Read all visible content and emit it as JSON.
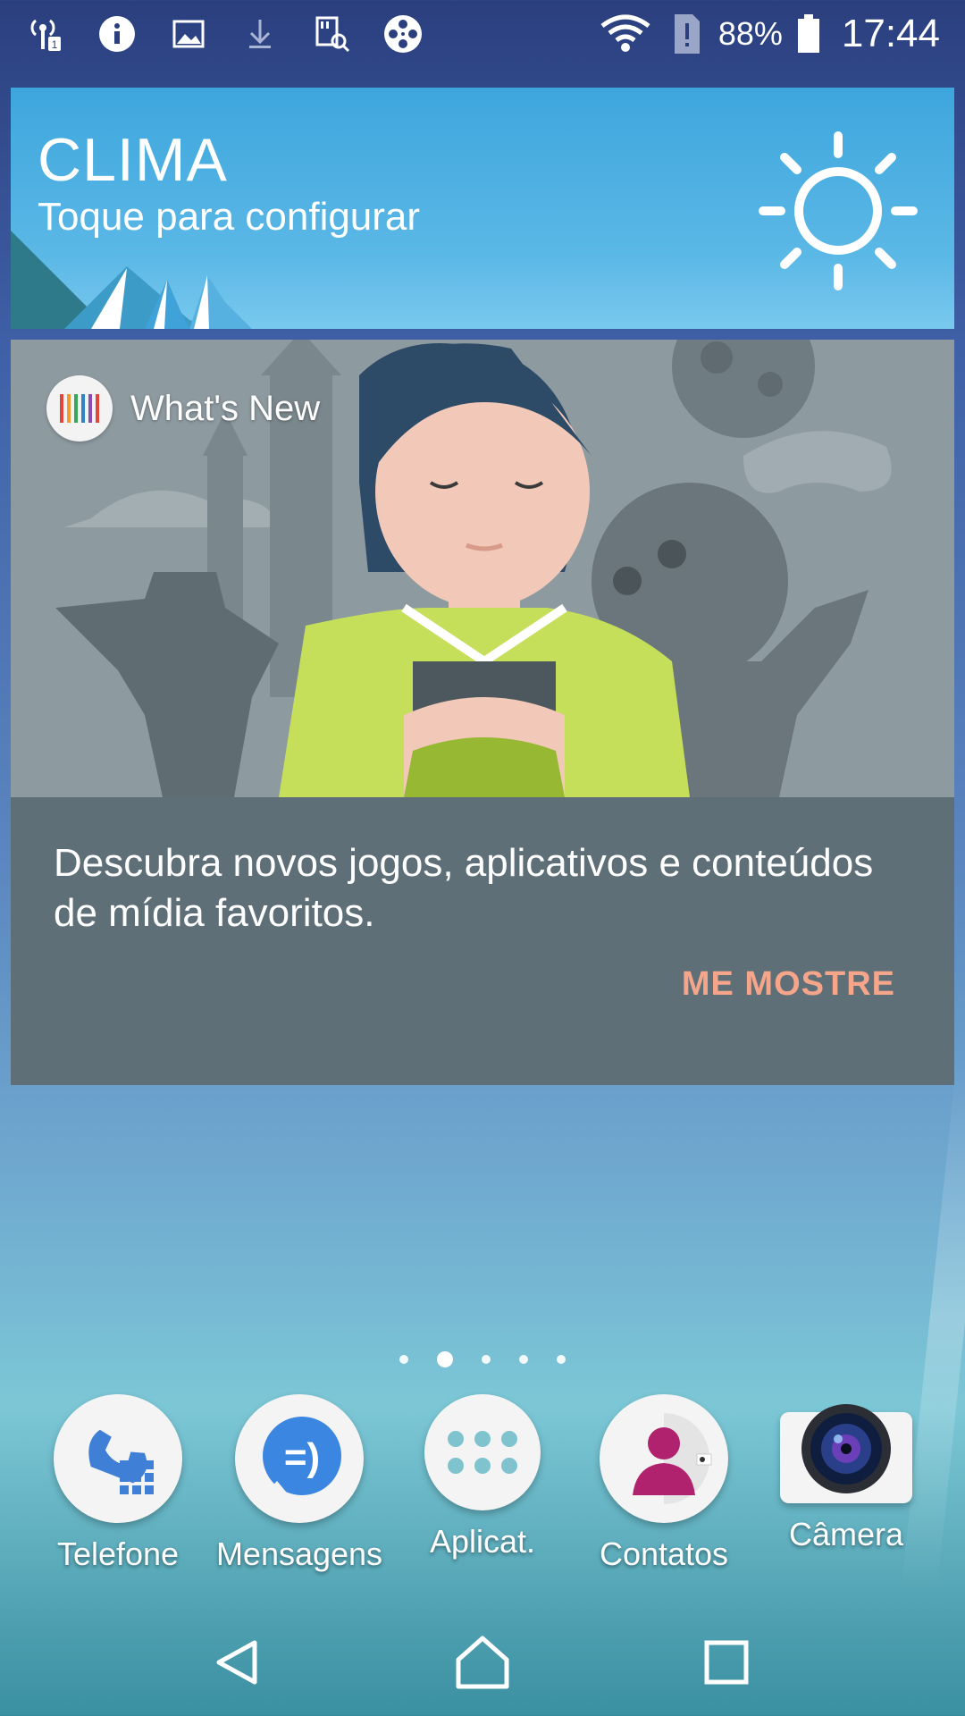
{
  "status_bar": {
    "left_icons": [
      "signal-sim1-icon",
      "info-icon",
      "image-icon",
      "download-icon",
      "sd-search-icon",
      "film-reel-icon"
    ],
    "right_icons": [
      "wifi-icon",
      "sim-alert-icon",
      "battery-icon"
    ],
    "battery_percent": "88%",
    "time": "17:44"
  },
  "weather_widget": {
    "title": "CLIMA",
    "subtitle": "Toque para configurar",
    "icon": "sun-icon"
  },
  "whats_new_card": {
    "app_name": "What's New",
    "description": "Descubra novos jogos, aplicativos e conteúdos de mídia favoritos.",
    "action_label": "ME MOSTRE",
    "action_color": "#f4a58a"
  },
  "page_indicator": {
    "count": 5,
    "active_index": 1
  },
  "dock": [
    {
      "label": "Telefone",
      "icon": "phone-icon"
    },
    {
      "label": "Mensagens",
      "icon": "messages-icon"
    },
    {
      "label": "Aplicat.",
      "icon": "app-drawer-icon"
    },
    {
      "label": "Contatos",
      "icon": "contacts-icon"
    },
    {
      "label": "Câmera",
      "icon": "camera-icon"
    }
  ],
  "nav_bar": [
    "back-icon",
    "home-icon",
    "recents-icon"
  ]
}
